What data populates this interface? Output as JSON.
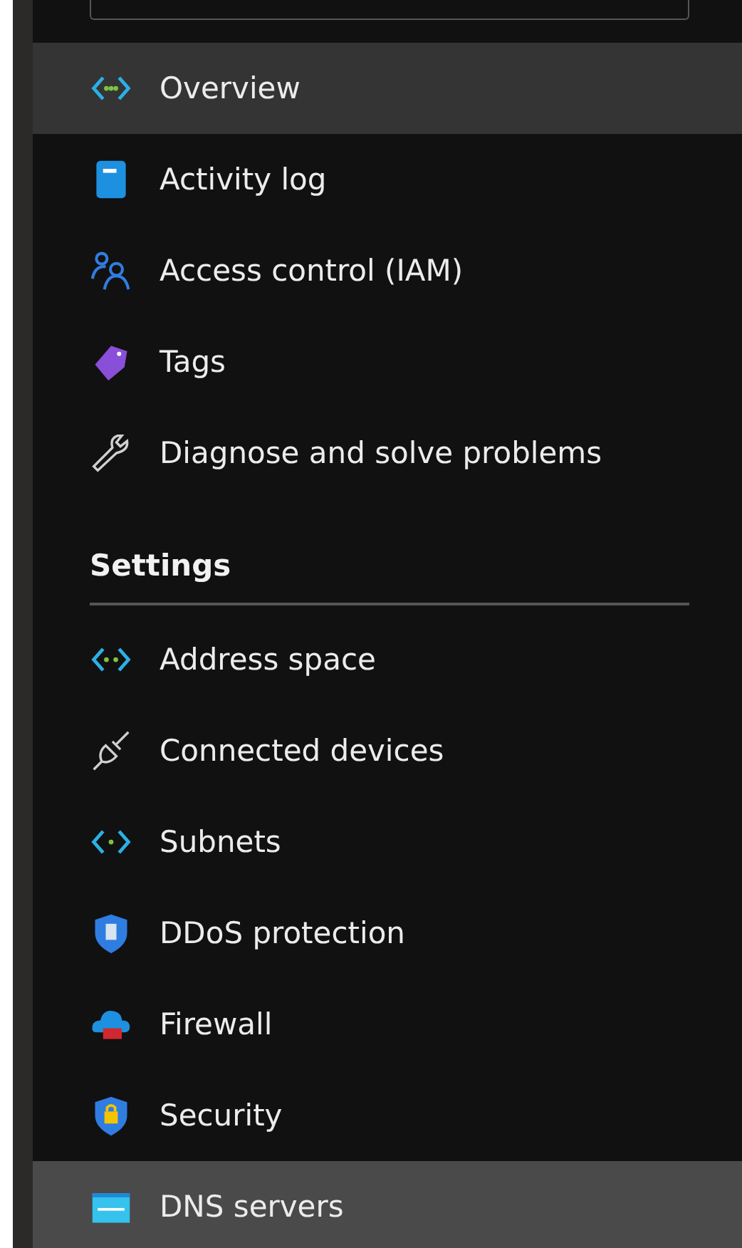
{
  "search": {
    "kind": "field"
  },
  "items": [
    {
      "label": "Overview",
      "kind": "brackets",
      "selected": true,
      "hovered": false
    },
    {
      "label": "Activity log",
      "kind": "notebook",
      "selected": false,
      "hovered": false
    },
    {
      "label": "Access control (IAM)",
      "kind": "people",
      "selected": false,
      "hovered": false
    },
    {
      "label": "Tags",
      "kind": "tag",
      "selected": false,
      "hovered": false
    },
    {
      "label": "Diagnose and solve problems",
      "kind": "wrench",
      "selected": false,
      "hovered": false
    }
  ],
  "sections": [
    {
      "title": "Settings",
      "items": [
        {
          "label": "Address space",
          "kind": "brackets2",
          "selected": false,
          "hovered": false
        },
        {
          "label": "Connected devices",
          "kind": "plug",
          "selected": false,
          "hovered": false
        },
        {
          "label": "Subnets",
          "kind": "brackets1",
          "selected": false,
          "hovered": false
        },
        {
          "label": "DDoS protection",
          "kind": "shield",
          "selected": false,
          "hovered": false
        },
        {
          "label": "Firewall",
          "kind": "cloud",
          "selected": false,
          "hovered": false
        },
        {
          "label": "Security",
          "kind": "lockshield",
          "selected": false,
          "hovered": false
        },
        {
          "label": "DNS servers",
          "kind": "card",
          "selected": false,
          "hovered": true
        }
      ]
    }
  ]
}
